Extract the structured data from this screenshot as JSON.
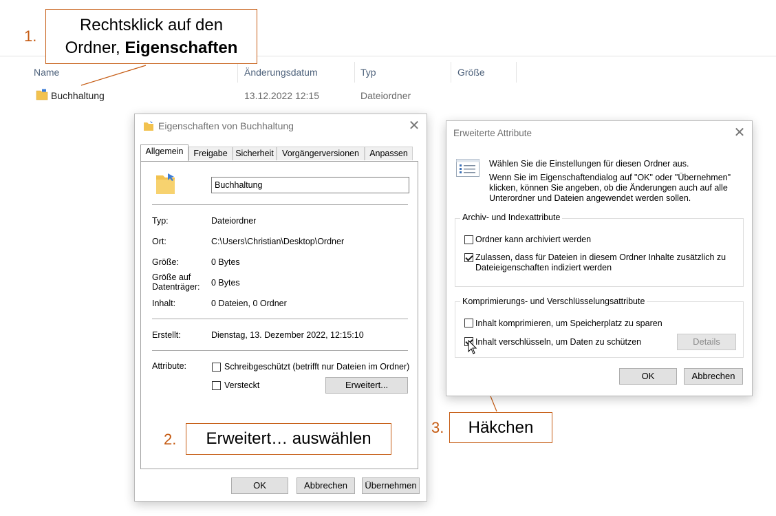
{
  "explorer": {
    "columns": [
      "Name",
      "Änderungsdatum",
      "Typ",
      "Größe"
    ],
    "row": {
      "name": "Buchhaltung",
      "modified": "13.12.2022 12:15",
      "type": "Dateiordner",
      "size": ""
    }
  },
  "callouts": {
    "step1": {
      "number": "1.",
      "line1": "Rechtsklick auf den",
      "line2_prefix": "Ordner, ",
      "line2_bold": "Eigenschaften"
    },
    "step2": {
      "number": "2.",
      "text": "Erweitert… auswählen"
    },
    "step3": {
      "number": "3.",
      "text": "Häkchen"
    }
  },
  "properties_dialog": {
    "title": "Eigenschaften von Buchhaltung",
    "tabs": [
      "Allgemein",
      "Freigabe",
      "Sicherheit",
      "Vorgängerversionen",
      "Anpassen"
    ],
    "active_tab": "Allgemein",
    "folder_name": "Buchhaltung",
    "fields": {
      "type_label": "Typ:",
      "type_value": "Dateiordner",
      "location_label": "Ort:",
      "location_value": "C:\\Users\\Christian\\Desktop\\Ordner",
      "size_label": "Größe:",
      "size_value": "0 Bytes",
      "disk_size_label_1": "Größe auf",
      "disk_size_label_2": "Datenträger:",
      "disk_size_value": "0 Bytes",
      "contents_label": "Inhalt:",
      "contents_value": "0 Dateien, 0 Ordner",
      "created_label": "Erstellt:",
      "created_value": "Dienstag, 13. Dezember 2022, 12:15:10",
      "attributes_label": "Attribute:"
    },
    "readonly_label": "Schreibgeschützt (betrifft nur Dateien im Ordner)",
    "readonly_checked": false,
    "hidden_label": "Versteckt",
    "hidden_checked": false,
    "advanced_button": "Erweitert...",
    "ok_button": "OK",
    "cancel_button": "Abbrechen",
    "apply_button": "Übernehmen"
  },
  "advanced_dialog": {
    "title": "Erweiterte Attribute",
    "intro_1": "Wählen Sie die Einstellungen für diesen Ordner aus.",
    "intro_2a": "Wenn Sie im Eigenschaftendialog auf \"OK\" oder \"Übernehmen\"",
    "intro_2b": "klicken, können Sie angeben, ob die Änderungen auch auf alle",
    "intro_2c": "Unterordner und Dateien angewendet werden sollen.",
    "archive_group": "Archiv- und Indexattribute",
    "archive_label": "Ordner kann archiviert werden",
    "archive_checked": false,
    "index_label_1": "Zulassen, dass für Dateien in diesem Ordner Inhalte zusätzlich zu",
    "index_label_2": "Dateieigenschaften indiziert werden",
    "index_checked": true,
    "compress_group": "Komprimierungs- und Verschlüsselungsattribute",
    "compress_label": "Inhalt komprimieren, um Speicherplatz zu sparen",
    "compress_checked": false,
    "encrypt_label": "Inhalt verschlüsseln, um Daten zu schützen",
    "encrypt_checked": true,
    "details_button": "Details",
    "ok_button": "OK",
    "cancel_button": "Abbrechen"
  },
  "colors": {
    "accent": "#c55a11",
    "folder": "#f2c24f",
    "header_text": "#4c607a"
  }
}
